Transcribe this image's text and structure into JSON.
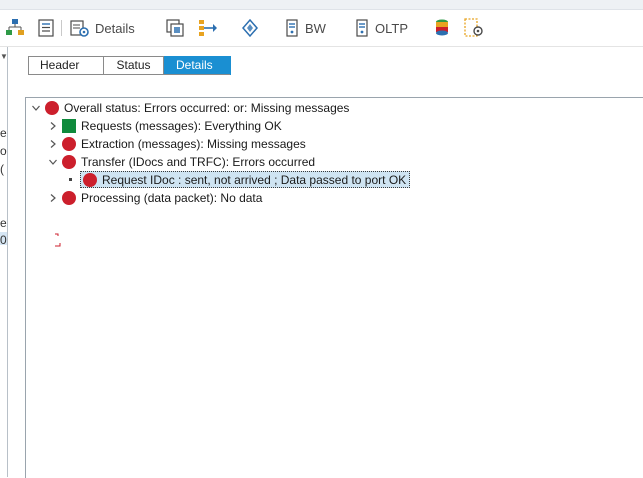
{
  "toolbar": {
    "details_label": "Details",
    "bw_label": "BW",
    "oltp_label": "OLTP",
    "icons": [
      "org-hierarchy-icon",
      "list-document-icon",
      "details-gear-icon",
      "copy-window-icon",
      "branch-arrows-icon",
      "diamond-flow-icon",
      "bw-server-icon",
      "oltp-server-icon",
      "database-stack-icon",
      "settings-page-icon"
    ]
  },
  "left_pane": {
    "fragments": [
      "ex",
      "o",
      "(",
      "ex",
      "0"
    ]
  },
  "tabs": [
    {
      "label": "Header",
      "active": false
    },
    {
      "label": "Status",
      "active": false
    },
    {
      "label": "Details",
      "active": true
    }
  ],
  "tree": {
    "root": {
      "label": "Overall status: Errors occurred: or: Missing messages",
      "status": "red"
    },
    "children": [
      {
        "label": "Requests (messages): Everything OK",
        "status": "green"
      },
      {
        "label": "Extraction (messages): Missing messages",
        "status": "red"
      },
      {
        "label": "Transfer (IDocs and TRFC): Errors occurred",
        "status": "red",
        "children": [
          {
            "label": "Request IDoc : sent, not arrived ; Data passed to port OK",
            "status": "red",
            "selected": true
          }
        ]
      },
      {
        "label": "Processing (data packet): No data",
        "status": "red"
      }
    ]
  },
  "colors": {
    "accent": "#1a8fd2",
    "error": "#cc1f2c",
    "ok": "#0f8a3c",
    "selection": "#cfe4f2"
  }
}
